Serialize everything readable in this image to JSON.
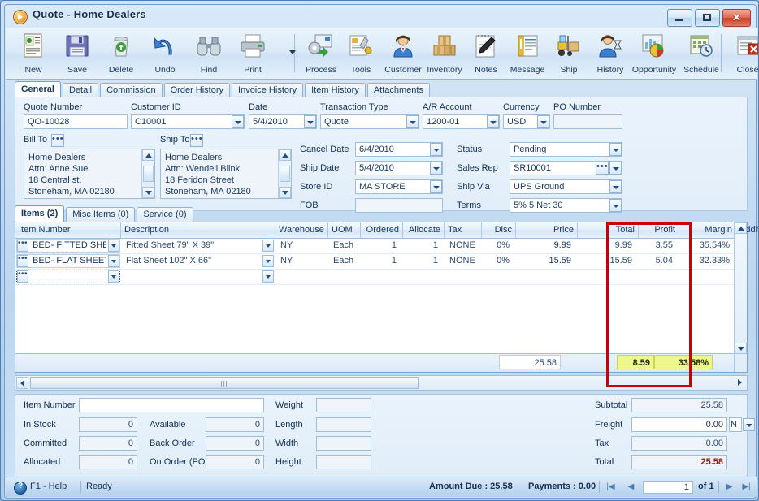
{
  "window": {
    "title": "Quote - Home Dealers",
    "icon": "quote-app-icon",
    "minimize": "minimize-icon",
    "maximize": "maximize-icon",
    "close": "close-icon"
  },
  "toolbar": {
    "buttons": [
      {
        "label": "New",
        "icon": "new-document-icon"
      },
      {
        "label": "Save",
        "icon": "floppy-disk-icon"
      },
      {
        "label": "Delete",
        "icon": "trash-can-icon"
      },
      {
        "label": "Undo",
        "icon": "undo-arrow-icon"
      },
      {
        "label": "Find",
        "icon": "binoculars-icon"
      },
      {
        "label": "Print",
        "icon": "printer-icon"
      },
      {
        "label": "Process",
        "icon": "gear-process-icon"
      },
      {
        "label": "Tools",
        "icon": "tools-icon"
      },
      {
        "label": "Customer",
        "icon": "customer-person-icon"
      },
      {
        "label": "Inventory",
        "icon": "boxes-icon"
      },
      {
        "label": "Notes",
        "icon": "notepad-pen-icon"
      },
      {
        "label": "Message",
        "icon": "message-icon"
      },
      {
        "label": "Ship",
        "icon": "forklift-icon"
      },
      {
        "label": "History",
        "icon": "person-hourglass-icon"
      },
      {
        "label": "Opportunity",
        "icon": "pie-chart-icon"
      },
      {
        "label": "Schedule",
        "icon": "calendar-clock-icon"
      },
      {
        "label": "Close",
        "icon": "close-window-icon"
      }
    ]
  },
  "tabs": [
    {
      "label": "General",
      "selected": true
    },
    {
      "label": "Detail",
      "selected": false
    },
    {
      "label": "Commission",
      "selected": false
    },
    {
      "label": "Order History",
      "selected": false
    },
    {
      "label": "Invoice History",
      "selected": false
    },
    {
      "label": "Item History",
      "selected": false
    },
    {
      "label": "Attachments",
      "selected": false
    }
  ],
  "general": {
    "quote_number": {
      "label": "Quote Number",
      "value": "QO-10028"
    },
    "customer_id": {
      "label": "Customer ID",
      "value": "C10001"
    },
    "date": {
      "label": "Date",
      "value": "5/4/2010"
    },
    "transaction_type": {
      "label": "Transaction Type",
      "value": "Quote"
    },
    "ar_account": {
      "label": "A/R Account",
      "value": "1200-01"
    },
    "currency": {
      "label": "Currency",
      "value": "USD"
    },
    "po_number": {
      "label": "PO Number",
      "value": ""
    },
    "bill_to": {
      "label": "Bill To",
      "lines": [
        "Home Dealers",
        "Attn: Anne Sue",
        "18 Central st.",
        "Stoneham, MA 02180"
      ]
    },
    "ship_to": {
      "label": "Ship To",
      "lines": [
        "Home Dealers",
        "Attn: Wendell Blink",
        "18 Feridon Street",
        "Stoneham, MA 02180"
      ]
    },
    "cancel_date": {
      "label": "Cancel  Date",
      "value": "6/4/2010"
    },
    "ship_date": {
      "label": "Ship Date",
      "value": "5/4/2010"
    },
    "store_id": {
      "label": "Store ID",
      "value": "MA STORE"
    },
    "fob": {
      "label": "FOB",
      "value": ""
    },
    "status": {
      "label": "Status",
      "value": "Pending"
    },
    "sales_rep": {
      "label": "Sales Rep",
      "value": "SR10001"
    },
    "ship_via": {
      "label": "Ship Via",
      "value": "UPS Ground"
    },
    "terms": {
      "label": "Terms",
      "value": "5% 5 Net 30"
    }
  },
  "item_tabs": [
    {
      "label": "Items (2)",
      "selected": true
    },
    {
      "label": "Misc Items (0)",
      "selected": false
    },
    {
      "label": "Service (0)",
      "selected": false
    }
  ],
  "grid": {
    "columns": [
      "Item Number",
      "Description",
      "Warehouse",
      "UOM",
      "Ordered",
      "Allocate",
      "Tax",
      "Disc",
      "Price",
      "Total",
      "Profit",
      "Margin",
      "Additional Ir"
    ],
    "rows": [
      {
        "item_number": "BED- FITTED SHEE",
        "description": "Fitted Sheet 79\" X 39\"",
        "warehouse": "NY",
        "uom": "Each",
        "ordered": "1",
        "allocate": "1",
        "tax": "NONE",
        "disc": "0%",
        "price": "9.99",
        "total": "9.99",
        "profit": "3.55",
        "margin": "35.54%",
        "additional": ""
      },
      {
        "item_number": "BED- FLAT SHEET",
        "description": "Flat Sheet 102\" X 66\"",
        "warehouse": "NY",
        "uom": "Each",
        "ordered": "1",
        "allocate": "1",
        "tax": "NONE",
        "disc": "0%",
        "price": "15.59",
        "total": "15.59",
        "profit": "5.04",
        "margin": "32.33%",
        "additional": ""
      },
      {
        "item_number": "",
        "description": "",
        "warehouse": "",
        "uom": "",
        "ordered": "",
        "allocate": "",
        "tax": "",
        "disc": "",
        "price": "",
        "total": "",
        "profit": "",
        "margin": "",
        "additional": ""
      }
    ],
    "footer": {
      "total": "25.58",
      "profit": "8.59",
      "margin": "33.58%"
    },
    "highlight_color": "#cc0000",
    "highlight_fill": "#eef78a"
  },
  "detail": {
    "item_number": {
      "label": "Item Number",
      "value": ""
    },
    "in_stock": {
      "label": "In Stock",
      "value": "0"
    },
    "committed": {
      "label": "Committed",
      "value": "0"
    },
    "allocated": {
      "label": "Allocated",
      "value": "0"
    },
    "available": {
      "label": "Available",
      "value": "0"
    },
    "back_order": {
      "label": "Back Order",
      "value": "0"
    },
    "on_order_po": {
      "label": "On Order (PO)",
      "value": "0"
    },
    "weight": {
      "label": "Weight",
      "value": ""
    },
    "length": {
      "label": "Length",
      "value": ""
    },
    "width": {
      "label": "Width",
      "value": ""
    },
    "height": {
      "label": "Height",
      "value": ""
    }
  },
  "totals": {
    "subtotal": {
      "label": "Subtotal",
      "value": "25.58"
    },
    "freight": {
      "label": "Freight",
      "value": "0.00",
      "mode": "N"
    },
    "tax": {
      "label": "Tax",
      "value": "0.00"
    },
    "total": {
      "label": "Total",
      "value": "25.58",
      "color": "#8b1a0a"
    }
  },
  "statusbar": {
    "help": "F1 - Help",
    "state": "Ready",
    "amount_due": "Amount Due : 25.58",
    "payments": "Payments : 0.00",
    "page": "1",
    "of": "of  1",
    "first": "first-record-icon",
    "prev": "previous-record-icon",
    "next": "next-record-icon",
    "last": "last-record-icon"
  }
}
